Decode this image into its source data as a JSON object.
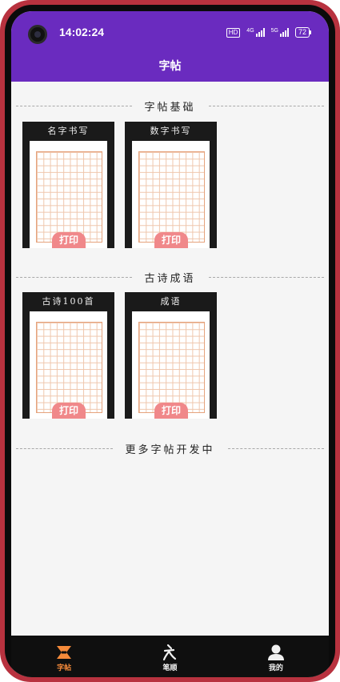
{
  "status_bar": {
    "time": "14:02:24",
    "hd": "HD",
    "sig1_label": "4G",
    "sig2_label": "5G",
    "battery": "72"
  },
  "header": {
    "title": "字帖"
  },
  "sections": [
    {
      "title": "字帖基础",
      "cards": [
        {
          "title": "名字书写",
          "button": "打印"
        },
        {
          "title": "数字书写",
          "button": "打印"
        }
      ]
    },
    {
      "title": "古诗成语",
      "cards": [
        {
          "title": "古诗100首",
          "button": "打印"
        },
        {
          "title": "成语",
          "button": "打印"
        }
      ]
    }
  ],
  "more_text": "更多字帖开发中",
  "bottom_nav": [
    {
      "label": "字帖",
      "icon": "copybook-icon",
      "active": true
    },
    {
      "label": "笔顺",
      "icon": "stroke-order-icon",
      "active": false
    },
    {
      "label": "我的",
      "icon": "profile-icon",
      "active": false
    }
  ],
  "colors": {
    "header_bg": "#6a2bbf",
    "accent": "#f58a3a",
    "print_button": "#f0888a",
    "grid_line": "#efc6ac",
    "phone_frame": "#b8323f"
  }
}
